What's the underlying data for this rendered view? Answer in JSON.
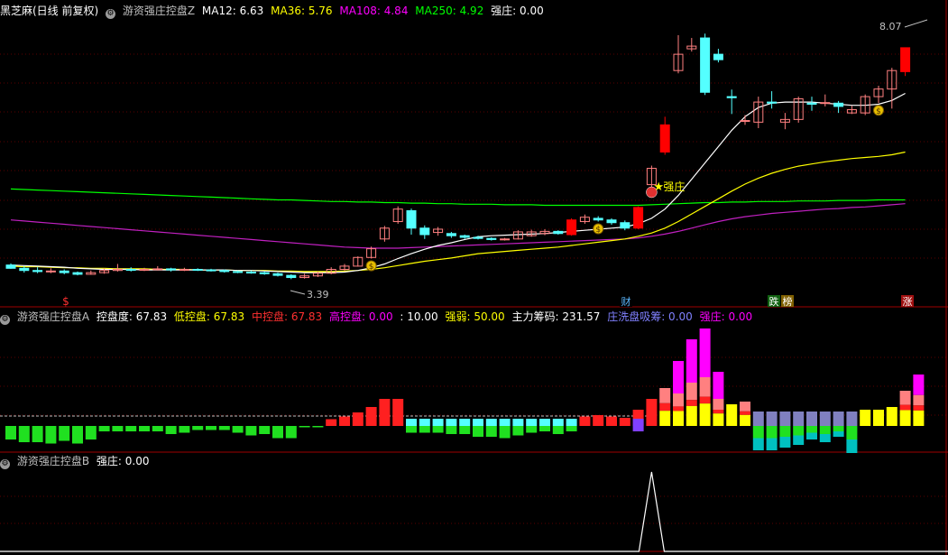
{
  "colors": {
    "up": "#ff8080",
    "up_solid": "#ff0000",
    "down": "#54ffff",
    "white": "#ffffff",
    "yellow": "#ffff00",
    "magenta": "#ff00ff",
    "green": "#00ff00",
    "purple": "#c020c0",
    "blue_grey": "#8080c0",
    "cyan": "#00c0c0",
    "pink": "#ff8080",
    "grid": "#5a0000"
  },
  "header_main": {
    "stock_name": "黑芝麻(日线 前复权)",
    "indicator_name": "游资强庄控盘Z",
    "ma12": "MA12: 6.63",
    "ma36": "MA36: 5.76",
    "ma108": "MA108: 4.84",
    "ma250": "MA250: 4.92",
    "qiangzhuang": "强庄: 0.00"
  },
  "header_a": {
    "indicator_name": "游资强庄控盘A",
    "kongpandu": "控盘度: 67.83",
    "dikongpan": "低控盘: 67.83",
    "zhongkongpan": "中控盘: 67.83",
    "gaokongpan": "高控盘: 0.00",
    "ref": ": 10.00",
    "qiangruo": "强弱: 50.00",
    "zhuli": "主力筹码: 231.57",
    "xichou": "庄洗盘吸筹: 0.00",
    "qiangzhuang": "强庄: 0.00"
  },
  "header_b": {
    "indicator_name": "游资强庄控盘B",
    "qiangzhuang": "强庄: 0.00"
  },
  "annotations": {
    "high_label": "8.07",
    "low_label": "3.39",
    "qiangzhuang_marker": "强庄",
    "tag_s": "$",
    "tag_cai": "财",
    "tag_die": "跌",
    "tag_bang": "榜",
    "tag_zhang": "涨"
  },
  "chart_data": [
    {
      "type": "candlestick",
      "title": "游资强庄控盘Z",
      "ylim": [
        3.2,
        8.2
      ],
      "candles": [
        [
          3.72,
          3.66,
          3.75,
          3.65
        ],
        [
          3.66,
          3.62,
          3.7,
          3.58
        ],
        [
          3.62,
          3.6,
          3.68,
          3.57
        ],
        [
          3.6,
          3.61,
          3.66,
          3.57
        ],
        [
          3.61,
          3.58,
          3.64,
          3.55
        ],
        [
          3.58,
          3.55,
          3.6,
          3.53
        ],
        [
          3.55,
          3.58,
          3.62,
          3.54
        ],
        [
          3.58,
          3.62,
          3.66,
          3.56
        ],
        [
          3.62,
          3.64,
          3.74,
          3.6
        ],
        [
          3.64,
          3.63,
          3.68,
          3.6
        ],
        [
          3.63,
          3.64,
          3.67,
          3.61
        ],
        [
          3.64,
          3.65,
          3.7,
          3.62
        ],
        [
          3.65,
          3.63,
          3.67,
          3.6
        ],
        [
          3.63,
          3.64,
          3.67,
          3.61
        ],
        [
          3.64,
          3.63,
          3.66,
          3.61
        ],
        [
          3.63,
          3.62,
          3.65,
          3.6
        ],
        [
          3.62,
          3.6,
          3.64,
          3.58
        ],
        [
          3.6,
          3.59,
          3.62,
          3.57
        ],
        [
          3.59,
          3.58,
          3.62,
          3.56
        ],
        [
          3.58,
          3.56,
          3.6,
          3.54
        ],
        [
          3.56,
          3.53,
          3.58,
          3.51
        ],
        [
          3.53,
          3.49,
          3.55,
          3.46
        ],
        [
          3.49,
          3.52,
          3.56,
          3.47
        ],
        [
          3.52,
          3.57,
          3.6,
          3.5
        ],
        [
          3.57,
          3.64,
          3.68,
          3.55
        ],
        [
          3.64,
          3.7,
          3.74,
          3.62
        ],
        [
          3.7,
          3.86,
          3.88,
          3.69
        ],
        [
          3.86,
          4.02,
          4.06,
          3.84
        ],
        [
          4.2,
          4.4,
          4.44,
          4.15
        ],
        [
          4.52,
          4.75,
          4.8,
          4.48
        ],
        [
          4.72,
          4.4,
          4.76,
          4.28
        ],
        [
          4.4,
          4.28,
          4.45,
          4.2
        ],
        [
          4.32,
          4.38,
          4.42,
          4.26
        ],
        [
          4.3,
          4.26,
          4.33,
          4.22
        ],
        [
          4.26,
          4.23,
          4.28,
          4.2
        ],
        [
          4.23,
          4.21,
          4.26,
          4.19
        ],
        [
          4.21,
          4.19,
          4.23,
          4.17
        ],
        [
          4.19,
          4.2,
          4.22,
          4.17
        ],
        [
          4.2,
          4.33,
          4.36,
          4.19
        ],
        [
          4.26,
          4.33,
          4.37,
          4.24
        ],
        [
          4.3,
          4.34,
          4.38,
          4.27
        ],
        [
          4.34,
          4.3,
          4.36,
          4.28
        ],
        [
          4.28,
          4.55,
          4.58,
          4.26
        ],
        [
          4.52,
          4.6,
          4.65,
          4.48
        ],
        [
          4.58,
          4.55,
          4.62,
          4.52
        ],
        [
          4.55,
          4.5,
          4.58,
          4.46
        ],
        [
          4.5,
          4.4,
          4.54,
          4.36
        ],
        [
          4.4,
          4.78,
          4.8,
          4.38
        ],
        [
          5.2,
          5.5,
          5.55,
          5.16
        ],
        [
          5.8,
          6.3,
          6.45,
          5.75
        ],
        [
          7.3,
          7.6,
          7.95,
          7.25
        ],
        [
          7.7,
          7.75,
          7.9,
          7.65
        ],
        [
          7.9,
          6.9,
          7.98,
          6.85
        ],
        [
          7.6,
          7.5,
          7.7,
          7.45
        ],
        [
          6.82,
          6.8,
          6.95,
          6.5
        ],
        [
          6.38,
          6.38,
          6.48,
          6.3
        ],
        [
          6.35,
          6.72,
          6.82,
          6.24
        ],
        [
          6.72,
          6.7,
          6.92,
          6.6
        ],
        [
          6.35,
          6.4,
          6.52,
          6.22
        ],
        [
          6.4,
          6.78,
          6.82,
          6.34
        ],
        [
          6.7,
          6.68,
          6.82,
          6.56
        ],
        [
          6.7,
          6.71,
          6.86,
          6.64
        ],
        [
          6.7,
          6.64,
          6.74,
          6.52
        ],
        [
          6.52,
          6.58,
          6.65,
          6.5
        ],
        [
          6.52,
          6.82,
          6.86,
          6.48
        ],
        [
          6.82,
          6.96,
          7.02,
          6.7
        ],
        [
          6.96,
          7.3,
          7.35,
          6.6
        ],
        [
          7.28,
          7.72,
          7.72,
          7.2
        ]
      ],
      "ma12": [
        3.72,
        3.71,
        3.7,
        3.69,
        3.68,
        3.66,
        3.65,
        3.64,
        3.64,
        3.64,
        3.63,
        3.63,
        3.63,
        3.63,
        3.63,
        3.63,
        3.63,
        3.62,
        3.62,
        3.61,
        3.6,
        3.59,
        3.58,
        3.58,
        3.58,
        3.59,
        3.62,
        3.67,
        3.74,
        3.84,
        3.93,
        4.01,
        4.08,
        4.13,
        4.19,
        4.24,
        4.26,
        4.27,
        4.28,
        4.29,
        4.3,
        4.32,
        4.34,
        4.36,
        4.38,
        4.4,
        4.42,
        4.48,
        4.58,
        4.75,
        5.0,
        5.3,
        5.6,
        5.9,
        6.2,
        6.45,
        6.62,
        6.7,
        6.72,
        6.72,
        6.72,
        6.7,
        6.68,
        6.66,
        6.66,
        6.68,
        6.75,
        6.88
      ],
      "ma36": [
        3.7,
        3.69,
        3.69,
        3.68,
        3.67,
        3.67,
        3.66,
        3.66,
        3.65,
        3.65,
        3.65,
        3.64,
        3.64,
        3.64,
        3.63,
        3.63,
        3.63,
        3.62,
        3.62,
        3.62,
        3.61,
        3.61,
        3.6,
        3.6,
        3.6,
        3.61,
        3.62,
        3.64,
        3.67,
        3.71,
        3.75,
        3.79,
        3.82,
        3.85,
        3.89,
        3.93,
        3.95,
        3.97,
        3.99,
        4.01,
        4.03,
        4.05,
        4.08,
        4.11,
        4.14,
        4.17,
        4.2,
        4.25,
        4.31,
        4.4,
        4.52,
        4.66,
        4.8,
        4.94,
        5.08,
        5.21,
        5.32,
        5.41,
        5.48,
        5.54,
        5.58,
        5.62,
        5.65,
        5.68,
        5.7,
        5.72,
        5.75,
        5.8
      ],
      "ma108": [
        4.55,
        4.53,
        4.51,
        4.49,
        4.47,
        4.45,
        4.43,
        4.41,
        4.39,
        4.37,
        4.35,
        4.33,
        4.31,
        4.29,
        4.27,
        4.25,
        4.23,
        4.21,
        4.19,
        4.17,
        4.15,
        4.13,
        4.11,
        4.09,
        4.07,
        4.05,
        4.04,
        4.03,
        4.03,
        4.03,
        4.04,
        4.05,
        4.06,
        4.07,
        4.08,
        4.09,
        4.1,
        4.11,
        4.12,
        4.13,
        4.14,
        4.15,
        4.16,
        4.17,
        4.18,
        4.19,
        4.2,
        4.22,
        4.25,
        4.29,
        4.34,
        4.4,
        4.46,
        4.52,
        4.57,
        4.61,
        4.64,
        4.67,
        4.69,
        4.71,
        4.73,
        4.75,
        4.76,
        4.78,
        4.79,
        4.81,
        4.83,
        4.85
      ],
      "ma250": [
        5.12,
        5.11,
        5.1,
        5.09,
        5.08,
        5.07,
        5.06,
        5.05,
        5.04,
        5.03,
        5.02,
        5.01,
        5.0,
        4.99,
        4.98,
        4.97,
        4.96,
        4.95,
        4.94,
        4.93,
        4.92,
        4.92,
        4.91,
        4.9,
        4.89,
        4.89,
        4.88,
        4.88,
        4.87,
        4.87,
        4.86,
        4.86,
        4.85,
        4.85,
        4.84,
        4.84,
        4.84,
        4.83,
        4.83,
        4.83,
        4.82,
        4.82,
        4.82,
        4.82,
        4.82,
        4.82,
        4.82,
        4.82,
        4.83,
        4.84,
        4.85,
        4.86,
        4.87,
        4.87,
        4.88,
        4.88,
        4.89,
        4.89,
        4.89,
        4.9,
        4.9,
        4.9,
        4.91,
        4.91,
        4.91,
        4.92,
        4.92,
        4.92
      ],
      "money_marks": [
        27,
        44,
        65
      ],
      "qiangzhuang_mark": 48
    },
    {
      "type": "bar",
      "title": "游资强庄控盘A",
      "baseline": 0,
      "stacks": [
        [
          -10,
          "green"
        ],
        [
          -12,
          "green"
        ],
        [
          -12,
          "green"
        ],
        [
          -13,
          "green"
        ],
        [
          -11,
          "green"
        ],
        [
          -13,
          "green"
        ],
        [
          -10,
          "green"
        ],
        [
          -4,
          "green"
        ],
        [
          -4,
          "green"
        ],
        [
          -4,
          "green"
        ],
        [
          -4,
          "green"
        ],
        [
          -4,
          "green"
        ],
        [
          -6,
          "green"
        ],
        [
          -5,
          "green"
        ],
        [
          -3,
          "green"
        ],
        [
          -3,
          "green"
        ],
        [
          -3,
          "green"
        ],
        [
          -5,
          "green"
        ],
        [
          -7,
          "green"
        ],
        [
          -6,
          "green"
        ],
        [
          -9,
          "green"
        ],
        [
          -9,
          "green"
        ],
        [
          -1,
          "green"
        ],
        [
          -1,
          "green"
        ],
        [
          5,
          "red"
        ],
        [
          7,
          "red"
        ],
        [
          10,
          "red"
        ],
        [
          14,
          "red"
        ],
        [
          20,
          "red"
        ],
        [
          20,
          "red"
        ],
        [
          -5,
          "cyan_down"
        ],
        [
          -5,
          "cyan_down"
        ],
        [
          -5,
          "cyan_down"
        ],
        [
          -6,
          "cyan_down"
        ],
        [
          -6,
          "cyan_down"
        ],
        [
          -8,
          "cyan_down"
        ],
        [
          -8,
          "cyan_down"
        ],
        [
          -9,
          "cyan_down"
        ],
        [
          -7,
          "cyan_down"
        ],
        [
          -5,
          "cyan_down"
        ],
        [
          -4,
          "cyan_down"
        ],
        [
          -6,
          "cyan_down"
        ],
        [
          -4,
          "cyan_down"
        ],
        [
          7,
          "red"
        ],
        [
          8,
          "red"
        ],
        [
          7,
          "red"
        ],
        [
          6,
          "red"
        ],
        [
          12,
          "purple"
        ],
        [
          20,
          "red_stack"
        ],
        [
          28,
          "pink_stack"
        ],
        [
          48,
          "mag_stack"
        ],
        [
          64,
          "mag_stack2"
        ],
        [
          72,
          "mag_stack3"
        ],
        [
          40,
          "mag_stack4"
        ],
        [
          16,
          "yellow"
        ],
        [
          18,
          "yellow_pink"
        ],
        [
          -18,
          "blue_mix"
        ],
        [
          -18,
          "blue_mix"
        ],
        [
          -16,
          "blue_mix"
        ],
        [
          -14,
          "blue_mix"
        ],
        [
          -10,
          "blue_mix"
        ],
        [
          -12,
          "blue_mix"
        ],
        [
          -8,
          "blue_mix"
        ],
        [
          -20,
          "blue_mix"
        ],
        [
          12,
          "yellow"
        ],
        [
          12,
          "yellow"
        ],
        [
          14,
          "yellow"
        ],
        [
          26,
          "yellow_pink"
        ],
        [
          38,
          "yellow_mag"
        ]
      ]
    },
    {
      "type": "line",
      "title": "游资强庄控盘B",
      "ylim": [
        0,
        1
      ],
      "spike_at": 48,
      "values": "zero except spike"
    }
  ]
}
